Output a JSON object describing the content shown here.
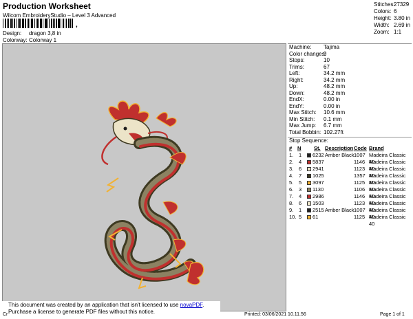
{
  "header": {
    "title": "Production Worksheet",
    "subtitle": "Wilcom EmbroideryStudio – Level 3 Advanced",
    "barcode_dots": ",",
    "design_label": "Design:",
    "design_value": "dragon 3,8 in",
    "colorway_label": "Colorway:",
    "colorway_value": "Colorway 1"
  },
  "summary": {
    "stitches_label": "Stitches:",
    "stitches": "27329",
    "colors_label": "Colors:",
    "colors": "6",
    "height_label": "Height:",
    "height": "3.80 in",
    "width_label": "Width:",
    "width": "2.69 in",
    "zoom_label": "Zoom:",
    "zoom": "1:1"
  },
  "details": [
    {
      "label": "Machine:",
      "value": "Tajima"
    },
    {
      "label": "Color changes:",
      "value": "9"
    },
    {
      "label": "Stops:",
      "value": "10"
    },
    {
      "label": "Trims:",
      "value": "67"
    },
    {
      "label": "Left:",
      "value": "34.2 mm"
    },
    {
      "label": "Right:",
      "value": "34.2 mm"
    },
    {
      "label": "Up:",
      "value": "48.2 mm"
    },
    {
      "label": "Down:",
      "value": "48.2 mm"
    },
    {
      "label": "EndX:",
      "value": "0.00 in"
    },
    {
      "label": "EndY:",
      "value": "0.00 in"
    },
    {
      "label": "Max Stitch:",
      "value": "10.6 mm"
    },
    {
      "label": "Min Stitch:",
      "value": "0.1 mm"
    },
    {
      "label": "Max Jump:",
      "value": "6.7 mm"
    },
    {
      "label": "Total Bobbin:",
      "value": "102.27ft"
    }
  ],
  "stop_sequence": {
    "title": "Stop Sequence:",
    "headers": {
      "num": "#",
      "n": "N",
      "st": "St.",
      "desc": "Description",
      "code": "Code",
      "brand": "Brand"
    },
    "rows": [
      {
        "num": "1.",
        "n": "1",
        "color": "#1f1f1f",
        "st": "6232",
        "desc": "Amber Black",
        "code": "1007",
        "brand": "Madeira Classic 40"
      },
      {
        "num": "2.",
        "n": "4",
        "color": "#c0302e",
        "st": "5837",
        "desc": "",
        "code": "1146",
        "brand": "Madeira Classic 40"
      },
      {
        "num": "3.",
        "n": "6",
        "color": "#ece4c8",
        "st": "2941",
        "desc": "",
        "code": "1123",
        "brand": "Madeira Classic 40"
      },
      {
        "num": "4.",
        "n": "7",
        "color": "#3e3a22",
        "st": "1025",
        "desc": "",
        "code": "1357",
        "brand": "Madeira Classic 40"
      },
      {
        "num": "5.",
        "n": "5",
        "color": "#f2b233",
        "st": "3097",
        "desc": "",
        "code": "1125",
        "brand": "Madeira Classic 40"
      },
      {
        "num": "6.",
        "n": "3",
        "color": "#8c8262",
        "st": "1130",
        "desc": "",
        "code": "1106",
        "brand": "Madeira Classic 40"
      },
      {
        "num": "7.",
        "n": "4",
        "color": "#c0302e",
        "st": "2986",
        "desc": "",
        "code": "1146",
        "brand": "Madeira Classic 40"
      },
      {
        "num": "8.",
        "n": "6",
        "color": "#ece4c8",
        "st": "1503",
        "desc": "",
        "code": "1123",
        "brand": "Madeira Classic 40"
      },
      {
        "num": "9.",
        "n": "1",
        "color": "#1f1f1f",
        "st": "2515",
        "desc": "Amber Black",
        "code": "1007",
        "brand": "Madeira Classic 40"
      },
      {
        "num": "10.",
        "n": "5",
        "color": "#f2b233",
        "st": "61",
        "desc": "",
        "code": "1125",
        "brand": "Madeira Classic 40"
      }
    ]
  },
  "notice": {
    "line1_prefix": "This document was created by an application that isn't licensed to use ",
    "link": "novaPDF",
    "line1_suffix": ".",
    "line2": "Purchase a license to generate PDF files without this notice."
  },
  "footer": {
    "left": "Cr",
    "printed": "Printed: 03/06/2021 10.11.56",
    "page": "Page 1 of 1"
  },
  "colors": {
    "design_bg": "#c8c8c8",
    "dragon_red": "#c0302e",
    "dragon_dark": "#3e3a22",
    "dragon_gold": "#f2b233",
    "dragon_cream": "#ece4c8"
  }
}
